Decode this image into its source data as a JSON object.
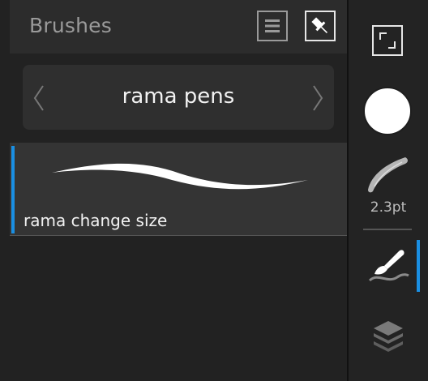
{
  "panel": {
    "title": "Brushes",
    "menu_icon": "hamburger-menu-icon",
    "pin_icon": "pin-icon"
  },
  "brush_set": {
    "name": "rama pens",
    "prev_icon": "chevron-left-icon",
    "next_icon": "chevron-right-icon"
  },
  "brushes": [
    {
      "name": "rama change size",
      "selected": true
    }
  ],
  "toolbar": {
    "fullscreen_icon": "fullscreen-icon",
    "color_swatch": "#ffffff",
    "brush_size_icon": "brush-stroke-icon",
    "brush_size_label": "2.3pt",
    "paint_icon": "brush-tool-icon",
    "layers_icon": "layers-icon"
  },
  "colors": {
    "accent": "#1a8fe3",
    "panel_bg": "#222222",
    "header_bg": "#2c2c2c"
  }
}
